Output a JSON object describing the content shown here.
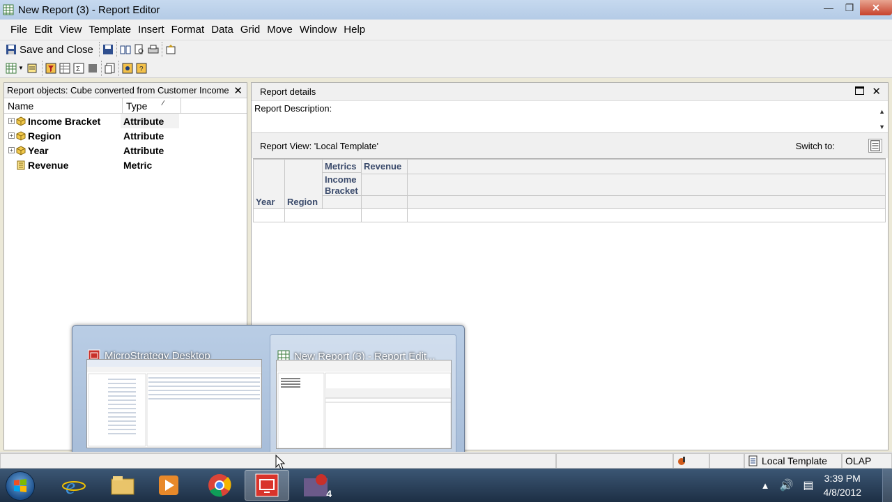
{
  "window": {
    "title": "New Report (3) - Report Editor"
  },
  "menu": [
    "File",
    "Edit",
    "View",
    "Template",
    "Insert",
    "Format",
    "Data",
    "Grid",
    "Move",
    "Window",
    "Help"
  ],
  "toolbar": {
    "save_close_label": "Save and Close"
  },
  "report_objects": {
    "header": "Report objects: Cube converted from Customer Income",
    "col_name": "Name",
    "col_type": "Type",
    "rows": [
      {
        "name": "Income Bracket",
        "type": "Attribute",
        "expandable": true,
        "icon": "attribute-icon"
      },
      {
        "name": "Region",
        "type": "Attribute",
        "expandable": true,
        "icon": "attribute-icon"
      },
      {
        "name": "Year",
        "type": "Attribute",
        "expandable": true,
        "icon": "attribute-icon"
      },
      {
        "name": "Revenue",
        "type": "Metric",
        "expandable": false,
        "icon": "metric-icon"
      }
    ]
  },
  "report_details": {
    "header": "Report details",
    "description_label": "Report Description:"
  },
  "report_view": {
    "header": "Report View: 'Local Template'",
    "switch_label": "Switch to:",
    "grid": {
      "metrics_label": "Metrics",
      "revenue_label": "Revenue",
      "income_label": "Income Bracket",
      "year_label": "Year",
      "region_label": "Region"
    }
  },
  "taskbar_popup": {
    "items": [
      {
        "title": "MicroStrategy Desktop",
        "icon": "microstrategy-icon"
      },
      {
        "title": "New Report (3) - Report Edit...",
        "icon": "report-grid-icon"
      }
    ]
  },
  "statusbar": {
    "template": "Local Template",
    "mode": "OLAP"
  },
  "taskbar": {
    "time": "3:39 PM",
    "date": "4/8/2012",
    "apps": [
      "internet-explorer-icon",
      "folder-icon",
      "media-player-icon",
      "chrome-icon",
      "microstrategy-icon",
      "microstrategy-4-icon"
    ],
    "active_app": "microstrategy-icon",
    "badge": "4"
  },
  "colors": {
    "grid_header_text": "#3a4a6b",
    "titlebar": "#c6d9ef",
    "taskbar": "#2a4160"
  }
}
